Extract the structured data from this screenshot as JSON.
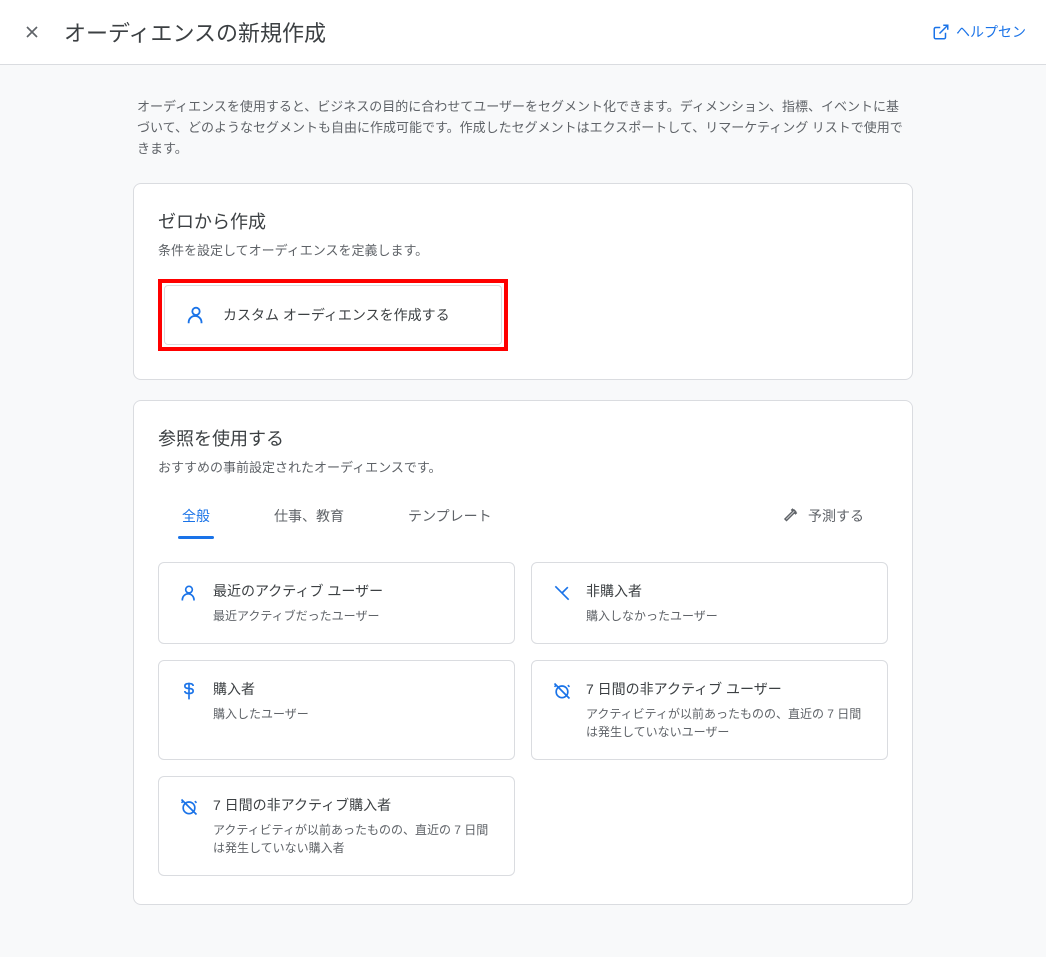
{
  "header": {
    "title": "オーディエンスの新規作成",
    "help_label": "ヘルプセン"
  },
  "description": "オーディエンスを使用すると、ビジネスの目的に合わせてユーザーをセグメント化できます。ディメンション、指標、イベントに基づいて、どのようなセグメントも自由に作成可能です。作成したセグメントはエクスポートして、リマーケティング リストで使用できます。",
  "scratch_section": {
    "title": "ゼロから作成",
    "subtitle": "条件を設定してオーディエンスを定義します。",
    "option_label": "カスタム オーディエンスを作成する"
  },
  "reference_section": {
    "title": "参照を使用する",
    "subtitle": "おすすめの事前設定されたオーディエンスです。",
    "tabs": [
      {
        "label": "全般"
      },
      {
        "label": "仕事、教育"
      },
      {
        "label": "テンプレート"
      },
      {
        "label": "予測する"
      }
    ],
    "templates": [
      {
        "icon": "person",
        "title": "最近のアクティブ ユーザー",
        "desc": "最近アクティブだったユーザー"
      },
      {
        "icon": "slash",
        "title": "非購入者",
        "desc": "購入しなかったユーザー"
      },
      {
        "icon": "dollar",
        "title": "購入者",
        "desc": "購入したユーザー"
      },
      {
        "icon": "alarm-off",
        "title": "7 日間の非アクティブ ユーザー",
        "desc": "アクティビティが以前あったものの、直近の 7 日間は発生していないユーザー"
      },
      {
        "icon": "alarm-off",
        "title": "7 日間の非アクティブ購入者",
        "desc": "アクティビティが以前あったものの、直近の 7 日間は発生していない購入者"
      }
    ]
  }
}
